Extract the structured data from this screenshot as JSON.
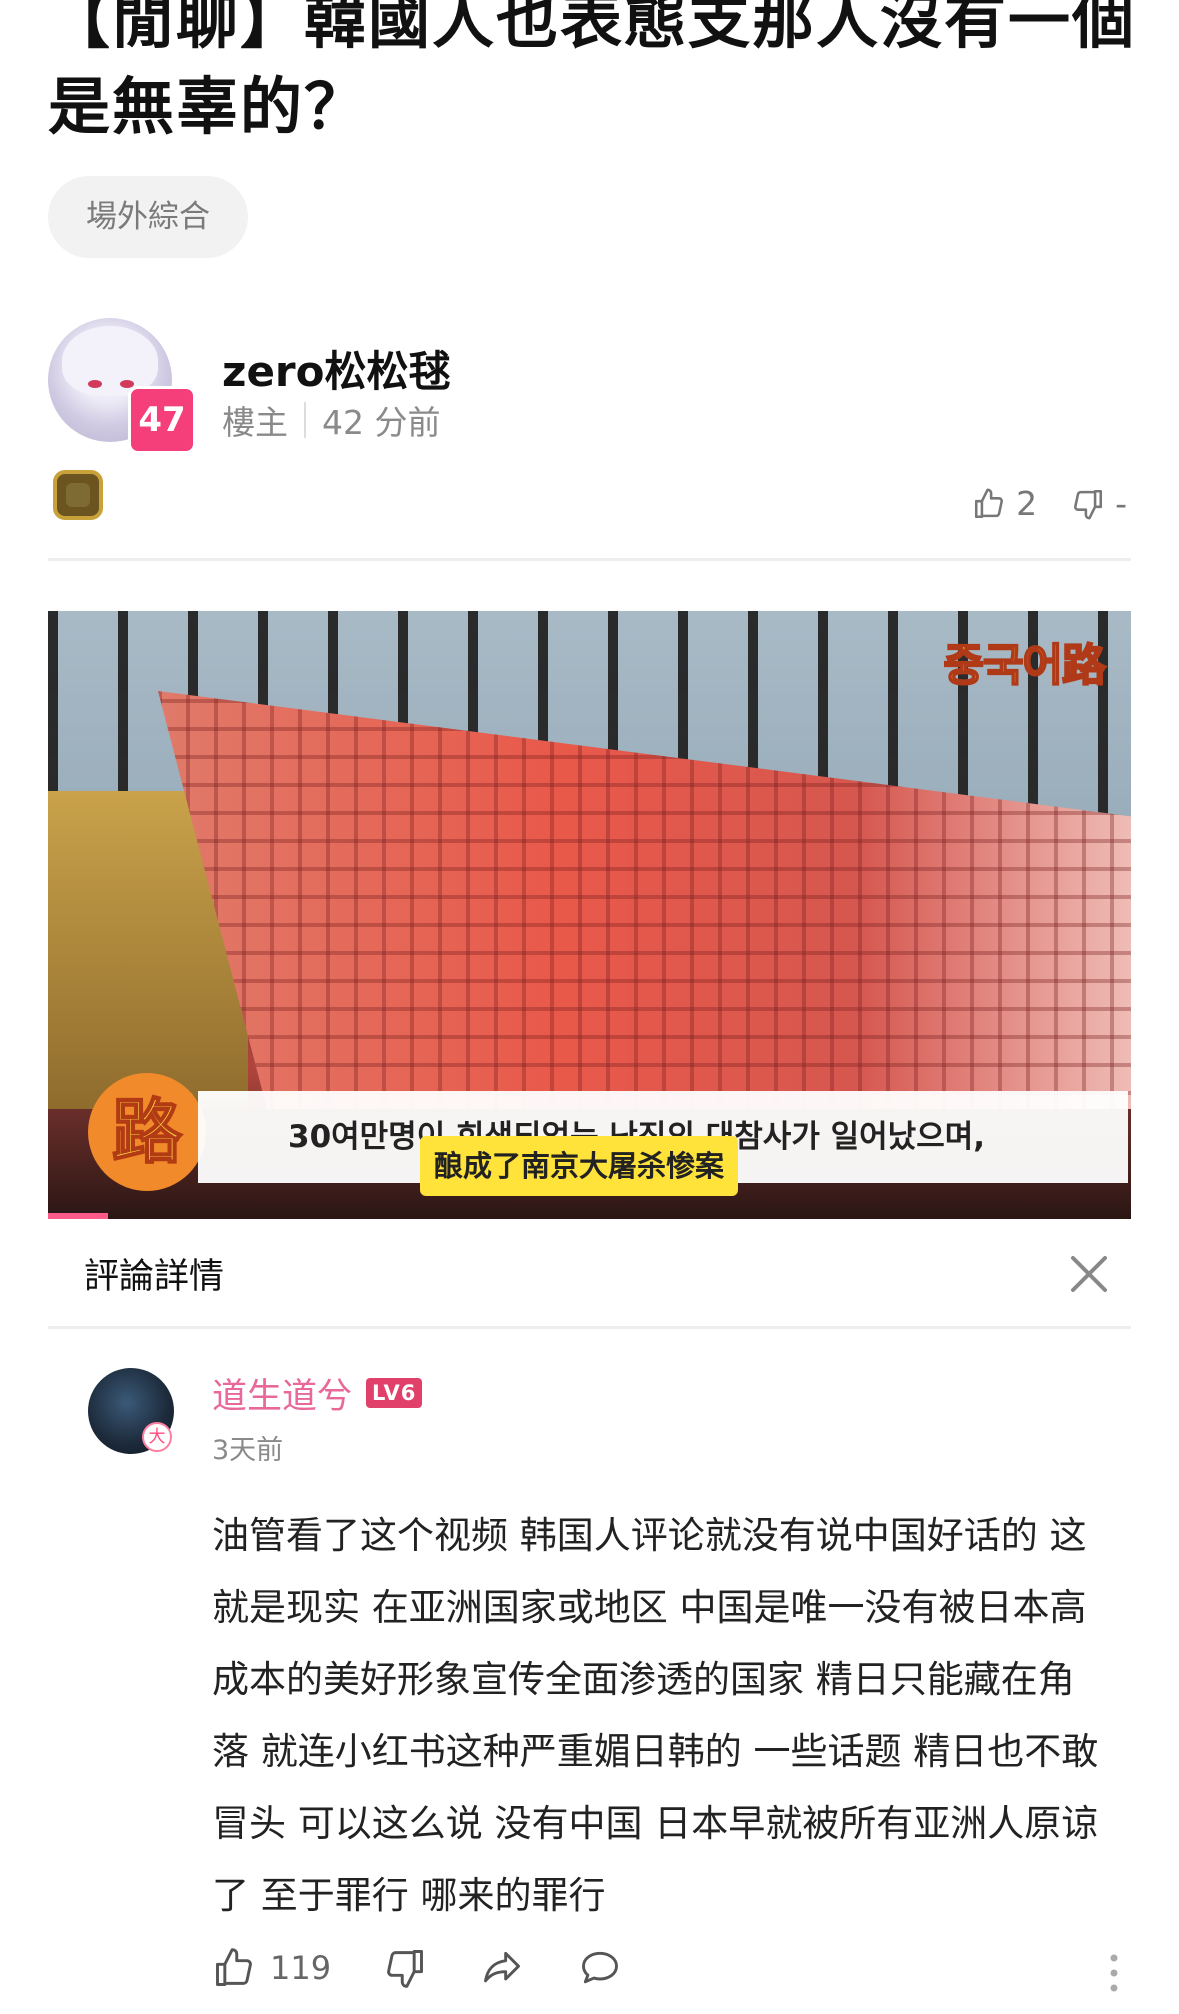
{
  "post": {
    "title": "【閒聊】韓國人也表態支那人沒有一個是無辜的？",
    "category_tag": "場外綜合",
    "author": {
      "name": "zero松松毬",
      "level": "47",
      "role": "樓主",
      "time": "42 分前"
    },
    "likes": "2",
    "dislikes": "-"
  },
  "video": {
    "channel_logo_text": "중국어路",
    "corner_logo_text": "路",
    "subtitle_korean": "30여만명이 희생되었는 난징의 대참사가 일어났으며,",
    "subtitle_chinese": "酿成了南京大屠杀惨案"
  },
  "comment_panel": {
    "title": "評論詳情",
    "comment": {
      "user": "道生道兮",
      "level_badge": "LV6",
      "avatar_badge": "大",
      "time": "3天前",
      "text": "油管看了这个视频 韩国人评论就没有说中国好话的 这就是现实 在亚洲国家或地区 中国是唯一没有被日本高成本的美好形象宣传全面渗透的国家 精日只能藏在角落 就连小红书这种严重媚日韩的 一些话题 精日也不敢冒头 可以这么说 没有中国 日本早就被所有亚洲人原谅了 至于罪行 哪来的罪行",
      "like_count": "119"
    }
  },
  "colors": {
    "level_badge": "#f43f7a",
    "comment_username": "#e8689a",
    "subtitle_highlight": "#ffe23a"
  }
}
